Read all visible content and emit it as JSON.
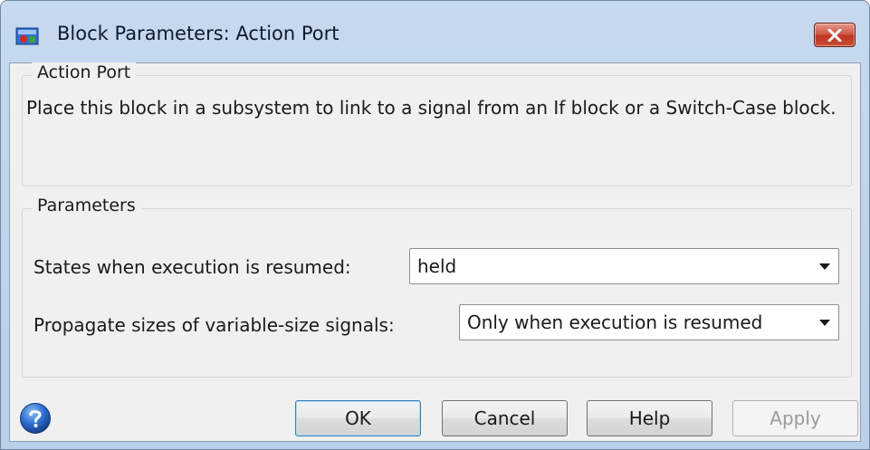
{
  "window": {
    "title": "Block Parameters: Action Port"
  },
  "description_group": {
    "legend": "Action Port",
    "text": "Place this block in a subsystem to link to a signal from an If block or a Switch-Case block."
  },
  "parameters_group": {
    "legend": "Parameters",
    "states": {
      "label": "States when execution is resumed:",
      "value": "held"
    },
    "propagate": {
      "label": "Propagate sizes of variable-size signals:",
      "value": "Only when execution is resumed"
    }
  },
  "buttons": {
    "ok": "OK",
    "cancel": "Cancel",
    "help": "Help",
    "apply": "Apply",
    "apply_enabled": false
  },
  "icons": {
    "app": "simulink-block-icon",
    "close": "close-icon",
    "help": "help-question-icon",
    "dropdown": "chevron-down-icon"
  },
  "colors": {
    "close_button": "#c7432c",
    "default_button_border": "#3c7fb1",
    "title_bar": "#c6d9ee"
  }
}
